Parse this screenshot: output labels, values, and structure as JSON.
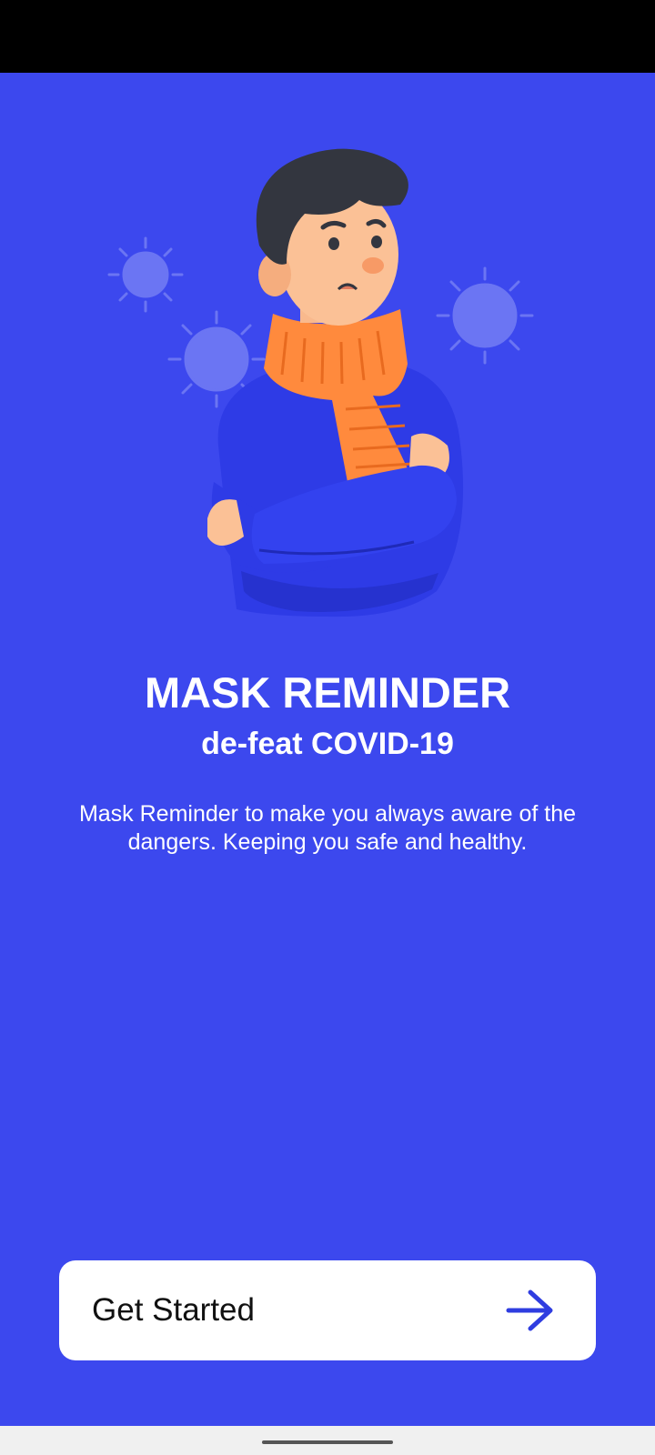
{
  "onboarding": {
    "title": "MASK REMINDER",
    "subtitle": "de-feat COVID-19",
    "description": "Mask Reminder to make you always aware of the dangers. Keeping you safe and healthy.",
    "illustration_icon": "sick-person-virus-illustration"
  },
  "cta": {
    "label": "Get Started",
    "icon": "arrow-right-icon"
  },
  "colors": {
    "background": "#3c48ee",
    "button_bg": "#ffffff",
    "accent": "#2f3de0",
    "scarf": "#ff8a3d",
    "sweater": "#2e3be6"
  }
}
